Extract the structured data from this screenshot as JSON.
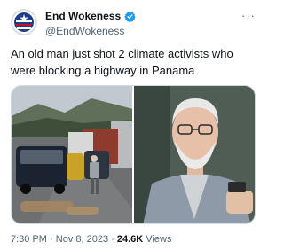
{
  "tweet": {
    "author": {
      "display_name": "End Wokeness",
      "handle": "@EndWokeness",
      "verified": true,
      "avatar_icon": "flag-seal-icon"
    },
    "more_label": "···",
    "text": "An old man just shot 2 climate activists who were blocking a highway in Panama",
    "media": {
      "count": 2
    },
    "meta": {
      "time": "7:30 PM",
      "separator": "·",
      "date": "Nov 8, 2023",
      "views_count": "24.6K",
      "views_label": "Views"
    },
    "colors": {
      "verified": "#1d9bf0",
      "secondary_text": "#536471",
      "primary_text": "#0f1419"
    }
  }
}
